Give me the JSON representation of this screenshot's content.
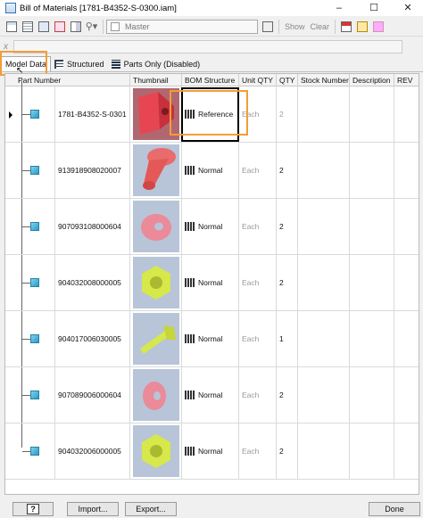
{
  "window": {
    "title": "Bill of Materials [1781-B4352-S-0300.iam]",
    "minimize": "–",
    "maximize": "☐",
    "close": "✕"
  },
  "toolbar": {
    "view_select": "Master",
    "show_label": "Show",
    "clear_label": "Clear"
  },
  "formula_bar": {
    "icon_label": "x",
    "value": ""
  },
  "tabs": [
    {
      "label": "Model Data",
      "active": true
    },
    {
      "label": "Structured",
      "active": false
    },
    {
      "label": "Parts Only (Disabled)",
      "active": false
    }
  ],
  "columns": [
    "Part Number",
    "Thumbnail",
    "BOM Structure",
    "Unit QTY",
    "QTY",
    "Stock Number",
    "Description",
    "REV"
  ],
  "rows": [
    {
      "part_number": "1781-B4352-S-0301",
      "thumbnail": "red-bracket",
      "bom_structure": "Reference",
      "unit_qty": "Each",
      "qty": "2"
    },
    {
      "part_number": "913918908020007",
      "thumbnail": "red-pin",
      "bom_structure": "Normal",
      "unit_qty": "Each",
      "qty": "2"
    },
    {
      "part_number": "907093108000604",
      "thumbnail": "pink-washer",
      "bom_structure": "Normal",
      "unit_qty": "Each",
      "qty": "2"
    },
    {
      "part_number": "904032008000005",
      "thumbnail": "yellow-nut",
      "bom_structure": "Normal",
      "unit_qty": "Each",
      "qty": "2"
    },
    {
      "part_number": "904017006030005",
      "thumbnail": "yellow-bolt",
      "bom_structure": "Normal",
      "unit_qty": "Each",
      "qty": "1"
    },
    {
      "part_number": "907089006000604",
      "thumbnail": "pink-washer",
      "bom_structure": "Normal",
      "unit_qty": "Each",
      "qty": "2"
    },
    {
      "part_number": "904032006000005",
      "thumbnail": "yellow-nut",
      "bom_structure": "Normal",
      "unit_qty": "Each",
      "qty": "2"
    }
  ],
  "footer": {
    "help_label": "?",
    "import_label": "Import...",
    "export_label": "Export...",
    "done_label": "Done"
  },
  "colors": {
    "highlight": "#f39c38",
    "cube": "#2a9bc6"
  }
}
